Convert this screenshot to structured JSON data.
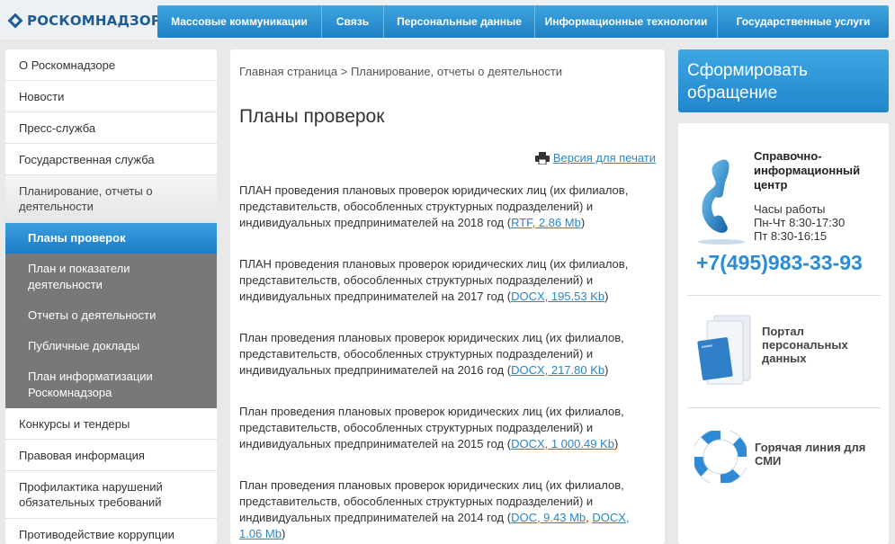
{
  "header": {
    "logo_text": "РОСКОМНАДЗОР",
    "nav": [
      {
        "label": "Массовые коммуникации"
      },
      {
        "label": "Связь"
      },
      {
        "label": "Персональные данные"
      },
      {
        "label": "Информационные технологии"
      },
      {
        "label": "Государственные услуги"
      }
    ]
  },
  "sidebar": {
    "items": [
      {
        "label": "О Роскомнадзоре"
      },
      {
        "label": "Новости"
      },
      {
        "label": "Пресс-служба"
      },
      {
        "label": "Государственная служба"
      },
      {
        "label": "Планирование, отчеты о деятельности"
      }
    ],
    "sub_items": [
      {
        "label": "Планы проверок"
      },
      {
        "label": "План и показатели деятельности"
      },
      {
        "label": "Отчеты о деятельности"
      },
      {
        "label": "Публичные доклады"
      },
      {
        "label": "План информатизации Роскомнадзора"
      }
    ],
    "items_after": [
      {
        "label": "Конкурсы и тендеры"
      },
      {
        "label": "Правовая информация"
      },
      {
        "label": "Профилактика нарушений обязательных требований"
      },
      {
        "label": "Противодействие коррупции"
      }
    ]
  },
  "main": {
    "breadcrumb": "Главная страница > Планирование, отчеты о деятельности",
    "title": "Планы проверок",
    "print_label": "Версия для печати",
    "plans": [
      {
        "text": "ПЛАН проведения плановых проверок юридических лиц (их филиалов, представительств, обособленных структурных подразделений) и индивидуальных предпринимателей на 2018 год",
        "files": [
          "RTF, 2.86 Mb"
        ]
      },
      {
        "text": "ПЛАН проведения плановых проверок юридических лиц (их филиалов, представительств, обособленных структурных подразделений) и индивидуальных предпринимателей на 2017 год",
        "files": [
          "DOCX, 195.53 Kb"
        ]
      },
      {
        "text": "План проведения плановых проверок юридических лиц (их филиалов, представительств, обособленных структурных подразделений) и индивидуальных предпринимателей на 2016 год",
        "files": [
          "DOCX, 217.80 Kb"
        ]
      },
      {
        "text": "План проведения плановых проверок юридических лиц (их филиалов, представительств, обособленных структурных подразделений) и индивидуальных предпринимателей на 2015 год",
        "files": [
          "DOCX, 1 000.49 Kb"
        ]
      },
      {
        "text": "План проведения плановых проверок юридических лиц (их филиалов, представительств, обособленных структурных подразделений) и индивидуальных предпринимателей на 2014 год",
        "files": [
          "DOC, 9.43 Mb",
          "DOCX, 1.06 Mb"
        ]
      }
    ]
  },
  "right": {
    "cta_label": "Сформировать обращение",
    "help_title": "Справочно-информационный центр",
    "hours_title": "Часы работы",
    "hours_weekdays": "Пн-Чт 8:30-17:30",
    "hours_friday": "Пт 8:30-16:15",
    "phone": "+7(495)983-33-93",
    "portal_label": "Портал персональных данных",
    "hotline_label": "Горячая линия для СМИ"
  },
  "colors": {
    "accent": "#2286cb",
    "link": "#2a86c8",
    "submenu_bg": "#787878"
  }
}
